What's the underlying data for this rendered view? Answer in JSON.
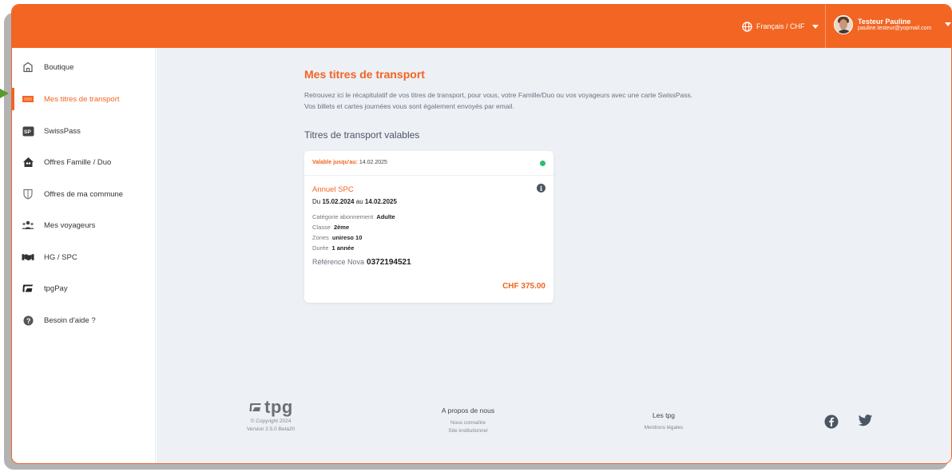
{
  "header": {
    "language_label": "Français / CHF",
    "user_name": "Testeur Pauline",
    "user_email": "pauline.testeur@yopmail.com"
  },
  "sidebar": {
    "items": [
      {
        "label": "Boutique",
        "icon": "shop-icon"
      },
      {
        "label": "Mes titres de transport",
        "icon": "ticket-icon",
        "active": true
      },
      {
        "label": "SwissPass",
        "icon": "swisspass-icon"
      },
      {
        "label": "Offres Famille / Duo",
        "icon": "family-icon"
      },
      {
        "label": "Offres de ma commune",
        "icon": "shield-icon"
      },
      {
        "label": "Mes voyageurs",
        "icon": "travelers-icon"
      },
      {
        "label": "HG / SPC",
        "icon": "handshake-icon"
      },
      {
        "label": "tpgPay",
        "icon": "tpgpay-icon"
      },
      {
        "label": "Besoin d'aide ?",
        "icon": "help-icon"
      }
    ]
  },
  "main": {
    "title": "Mes titres de transport",
    "description_line1": "Retrouvez ici le récapitulatif de vos titres de transport, pour vous, votre Famille/Duo ou vos voyageurs avec une carte SwissPass.",
    "description_line2": "Vos billets et cartes journées vous sont également envoyés par email.",
    "section_title": "Titres de transport valables",
    "card": {
      "validity_label": "Valable jusqu'au:",
      "validity_date": "14.02.2025",
      "status_color": "#2ebd6b",
      "product_name": "Annuel SPC",
      "dates_prefix": "Du",
      "date_from": "15.02.2024",
      "dates_mid": "au",
      "date_to": "14.02.2025",
      "attributes": [
        {
          "label": "Catégorie abonnement",
          "value": "Adulte"
        },
        {
          "label": "Classe",
          "value": "2ème"
        },
        {
          "label": "Zones",
          "value": "unireso 10"
        },
        {
          "label": "Durée",
          "value": "1 année"
        }
      ],
      "reference_label": "Référence Nova",
      "reference_value": "0372194521",
      "price": "CHF 375.00"
    }
  },
  "footer": {
    "logo_text": "tpg",
    "copyright": "© Copyright 2024",
    "version": "Version 2.5.0 Beta20",
    "about_title": "A propos de nous",
    "about_links": [
      "Nous connaître",
      "Site institutionnel"
    ],
    "tpg_title": "Les tpg",
    "tpg_links": [
      "Mentions légales"
    ]
  },
  "colors": {
    "brand": "#f26522",
    "background": "#edf0f5"
  }
}
